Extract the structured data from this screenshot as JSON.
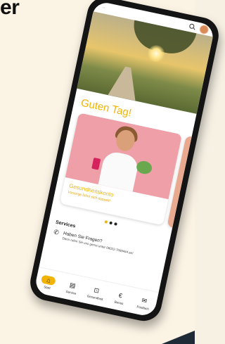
{
  "cover_text": "er",
  "status": {
    "time": "··"
  },
  "greeting": "Guten Tag!",
  "card": {
    "title": "Gesundheitskonto",
    "subtitle": "Vorsorge lohnt sich doppelt!"
  },
  "services": {
    "heading": "Services",
    "item": {
      "title": "Haben Sie Fragen?",
      "subtitle": "Dann rufen Sie uns gerne unter 06022-7069444 an!"
    }
  },
  "nav": {
    "items": [
      {
        "label": "Start",
        "icon": "home-icon",
        "glyph": "⌂"
      },
      {
        "label": "Service",
        "icon": "document-icon",
        "glyph": "▤"
      },
      {
        "label": "Gesundheit",
        "icon": "lock-icon",
        "glyph": "⊡"
      },
      {
        "label": "Bonus",
        "icon": "euro-icon",
        "glyph": "€"
      },
      {
        "label": "Postfach",
        "icon": "mail-icon",
        "glyph": "✉"
      }
    ]
  },
  "colors": {
    "accent": "#f2b400",
    "card_photo": "#ee9fa7"
  }
}
